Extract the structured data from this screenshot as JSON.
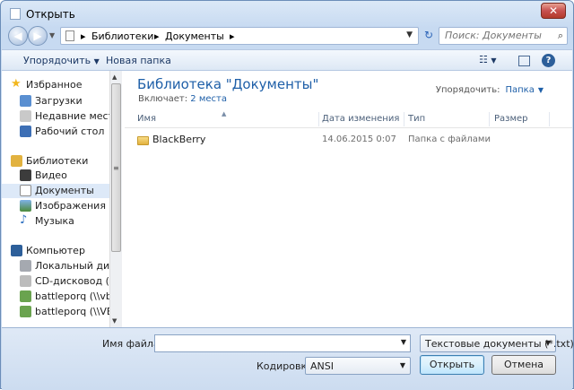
{
  "window": {
    "title": "Открыть",
    "close": "✕"
  },
  "nav": {
    "back": "◀",
    "forward": "▶",
    "breadcrumb": [
      "Библиотеки",
      "Документы"
    ],
    "separator": "▸",
    "search_placeholder": "Поиск: Документы"
  },
  "toolbar": {
    "organize": "Упорядочить",
    "new_folder": "Новая папка"
  },
  "sidebar": {
    "groups": [
      {
        "label": "Избранное",
        "icon": "star-icon",
        "color": "#f2b71e",
        "items": [
          {
            "label": "Загрузки",
            "icon": "downloads-icon"
          },
          {
            "label": "Недавние места",
            "icon": "recent-places-icon"
          },
          {
            "label": "Рабочий стол",
            "icon": "desktop-icon"
          }
        ]
      },
      {
        "label": "Библиотеки",
        "icon": "libraries-icon",
        "color": "#e2b23f",
        "items": [
          {
            "label": "Видео",
            "icon": "video-icon"
          },
          {
            "label": "Документы",
            "icon": "documents-icon",
            "selected": true
          },
          {
            "label": "Изображения",
            "icon": "images-icon"
          },
          {
            "label": "Музыка",
            "icon": "music-icon"
          }
        ]
      },
      {
        "label": "Компьютер",
        "icon": "computer-icon",
        "color": "#2d5f9a",
        "items": [
          {
            "label": "Локальный диск",
            "icon": "local-disk-icon"
          },
          {
            "label": "CD-дисковод (D:",
            "icon": "cd-drive-icon"
          },
          {
            "label": "battleporq (\\\\vbc",
            "icon": "network-drive-icon"
          },
          {
            "label": "battleporq (\\\\VB(",
            "icon": "network-drive-icon"
          }
        ]
      }
    ]
  },
  "library": {
    "title": "Библиотека \"Документы\"",
    "includes_label": "Включает:",
    "includes_link": "2 места",
    "arrange_label": "Упорядочить:",
    "arrange_value": "Папка"
  },
  "columns": [
    "Имя",
    "Дата изменения",
    "Тип",
    "Размер"
  ],
  "files": [
    {
      "name": "BlackBerry",
      "modified": "14.06.2015 0:07",
      "type": "Папка с файлами",
      "size": ""
    }
  ],
  "bottom": {
    "filename_label": "Имя файла:",
    "filename_value": "",
    "filetype": "Текстовые документы (*.txt)",
    "encoding_label": "Кодировка:",
    "encoding_value": "ANSI",
    "open_button": "Открыть",
    "cancel_button": "Отмена"
  }
}
